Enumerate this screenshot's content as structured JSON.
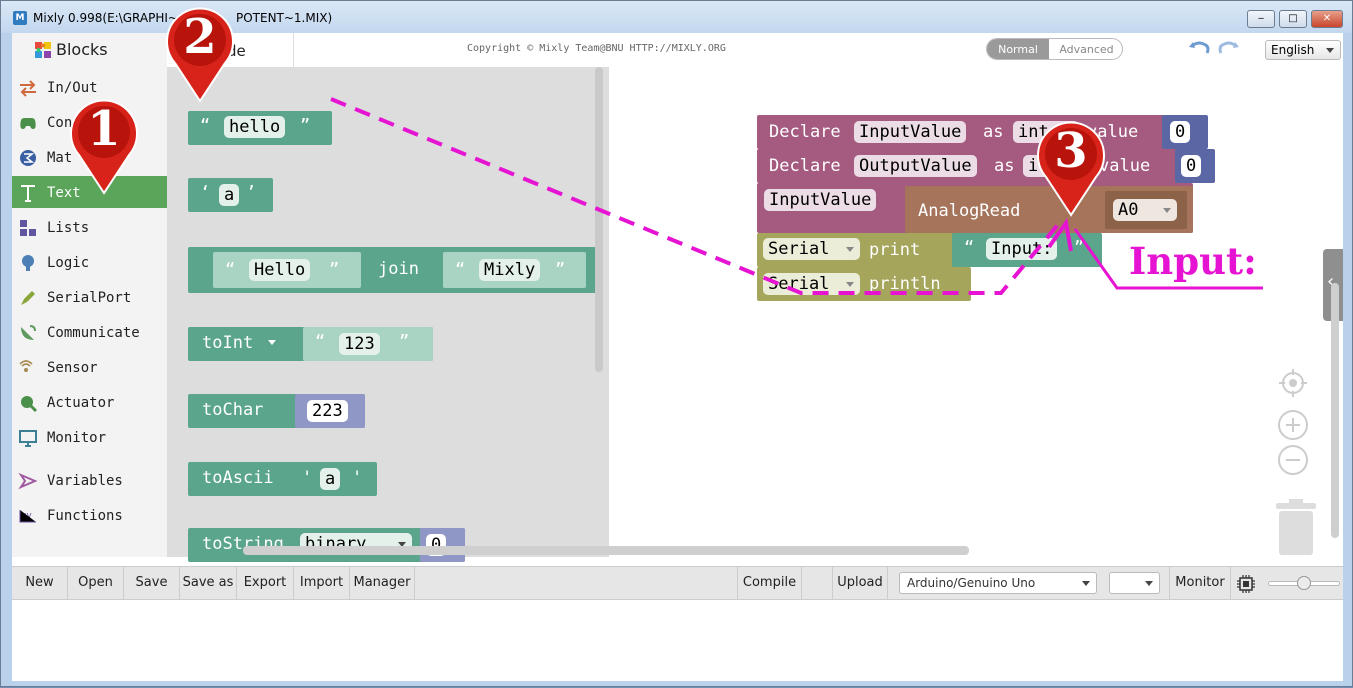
{
  "window": {
    "title": "Mixly 0.998(E:\\GRAPHI~                    POTENT~1.MIX)",
    "title_left": "Mixly 0.998(E:\\GRAPHI~",
    "title_right": "POTENT~1.MIX)",
    "minimize": "‒",
    "maximize": "□",
    "close": "✕"
  },
  "topbar": {
    "tab_blocks": "Blocks",
    "tab_code": "de",
    "copyright": "Copyright © Mixly Team@BNU HTTP://MIXLY.ORG",
    "mode_normal": "Normal",
    "mode_advanced": "Advanced",
    "language": "English"
  },
  "sidebar": {
    "items": [
      {
        "label": "In/Out",
        "icon": "arrows-icon",
        "color": "#d06a3e"
      },
      {
        "label": "Con",
        "icon": "gamepad-icon",
        "color": "#4a8f4a"
      },
      {
        "label": "Mat",
        "icon": "math-icon",
        "color": "#3b5fa3"
      },
      {
        "label": "Text",
        "icon": "text-icon",
        "color": "#333333"
      },
      {
        "label": "Lists",
        "icon": "list-icon",
        "color": "#6155a0"
      },
      {
        "label": "Logic",
        "icon": "bulb-icon",
        "color": "#4c7fb5"
      },
      {
        "label": "SerialPort",
        "icon": "pen-icon",
        "color": "#8aa63a"
      },
      {
        "label": "Communicate",
        "icon": "satellite-icon",
        "color": "#5e9a5e"
      },
      {
        "label": "Sensor",
        "icon": "sensor-icon",
        "color": "#a78a52"
      },
      {
        "label": "Actuator",
        "icon": "actuator-icon",
        "color": "#4a8f4a"
      },
      {
        "label": "Monitor",
        "icon": "monitor-icon",
        "color": "#3d7f95"
      },
      {
        "label": "Variables",
        "icon": "variables-icon",
        "color": "#a05ba0"
      },
      {
        "label": "Functions",
        "icon": "functions-icon",
        "color": "#6a4ea3"
      }
    ]
  },
  "flyout": {
    "b1_text": "hello",
    "b2_char": "a",
    "b3_left": "Hello",
    "b3_join": "join",
    "b3_right": "Mixly",
    "b4_fn": "toInt",
    "b4_val": "123",
    "b5_fn": "toChar",
    "b5_val": "223",
    "b6_fn": "toAscii",
    "b6_q": "'",
    "b6_val": "a",
    "b7_fn": "toString",
    "b7_opt": "binary",
    "b7_val": "0",
    "quote_open": "“",
    "quote_close": "”",
    "squote_open": "‘",
    "squote_close": "’"
  },
  "workspace": {
    "declare1": {
      "kw": "Declare",
      "name": "InputValue",
      "as": "as",
      "type": "int",
      "value_kw": "value",
      "value": "0"
    },
    "declare2": {
      "kw": "Declare",
      "name": "OutputValue",
      "as": "as",
      "type": "i",
      "value_kw": "value",
      "value": "0"
    },
    "assign": {
      "var": "InputValue",
      "fn": "AnalogRead",
      "pin": "A0"
    },
    "print": {
      "target": "Serial",
      "fn": "print",
      "text": "Input:"
    },
    "println": {
      "target": "Serial",
      "fn": "println"
    },
    "annotation": "Input:"
  },
  "markers": [
    "1",
    "2",
    "3"
  ],
  "toolbar": {
    "new": "New",
    "open": "Open",
    "save": "Save",
    "save_as": "Save as",
    "export": "Export",
    "import": "Import",
    "manager": "Manager",
    "compile": "Compile",
    "upload": "Upload",
    "board": "Arduino/Genuino Uno",
    "port": "",
    "monitor": "Monitor"
  },
  "colors": {
    "text_block": "#5ba58c",
    "text_block_light": "#a9d3c3",
    "var_block": "#a55b80",
    "var_value": "#5b67a5",
    "serial_block": "#a5a55b",
    "io_block": "#a5745b",
    "marker": "#d8231a",
    "annotation": "#e614d2"
  }
}
